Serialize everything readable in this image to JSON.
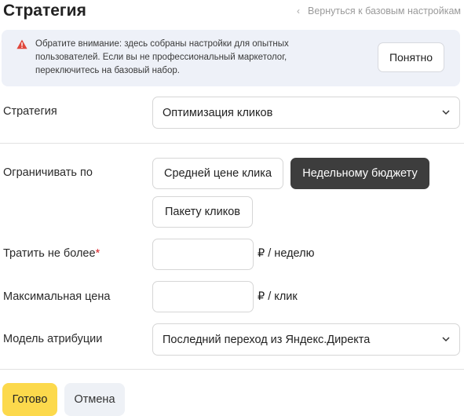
{
  "header": {
    "title": "Стратегия",
    "back_link": "Вернуться к базовым настройкам"
  },
  "notice": {
    "text": "Обратите внимание: здесь собраны настройки для опытных пользователей. Если вы не профессиональный маркетолог, переключитесь на базовый набор.",
    "ok_button": "Понятно",
    "icon": "warning-triangle-icon",
    "icon_color": "#e0473c",
    "background": "#eef1f8"
  },
  "strategy": {
    "label": "Стратегия",
    "value": "Оптимизация кликов"
  },
  "limit": {
    "label": "Ограничивать по",
    "options": [
      "Средней цене клика",
      "Недельному бюджету",
      "Пакету кликов"
    ],
    "selected": "Недельному бюджету"
  },
  "spend": {
    "label": "Тратить не более",
    "required_mark": "*",
    "value": "",
    "unit": "₽ / неделю"
  },
  "max_price": {
    "label": "Максимальная цена",
    "value": "",
    "unit": "₽ / клик"
  },
  "attribution": {
    "label": "Модель атрибуции",
    "value": "Последний переход из Яндекс.Директа"
  },
  "footer": {
    "done_button": "Готово",
    "cancel_button": "Отмена",
    "accent_color": "#fcd94c"
  }
}
